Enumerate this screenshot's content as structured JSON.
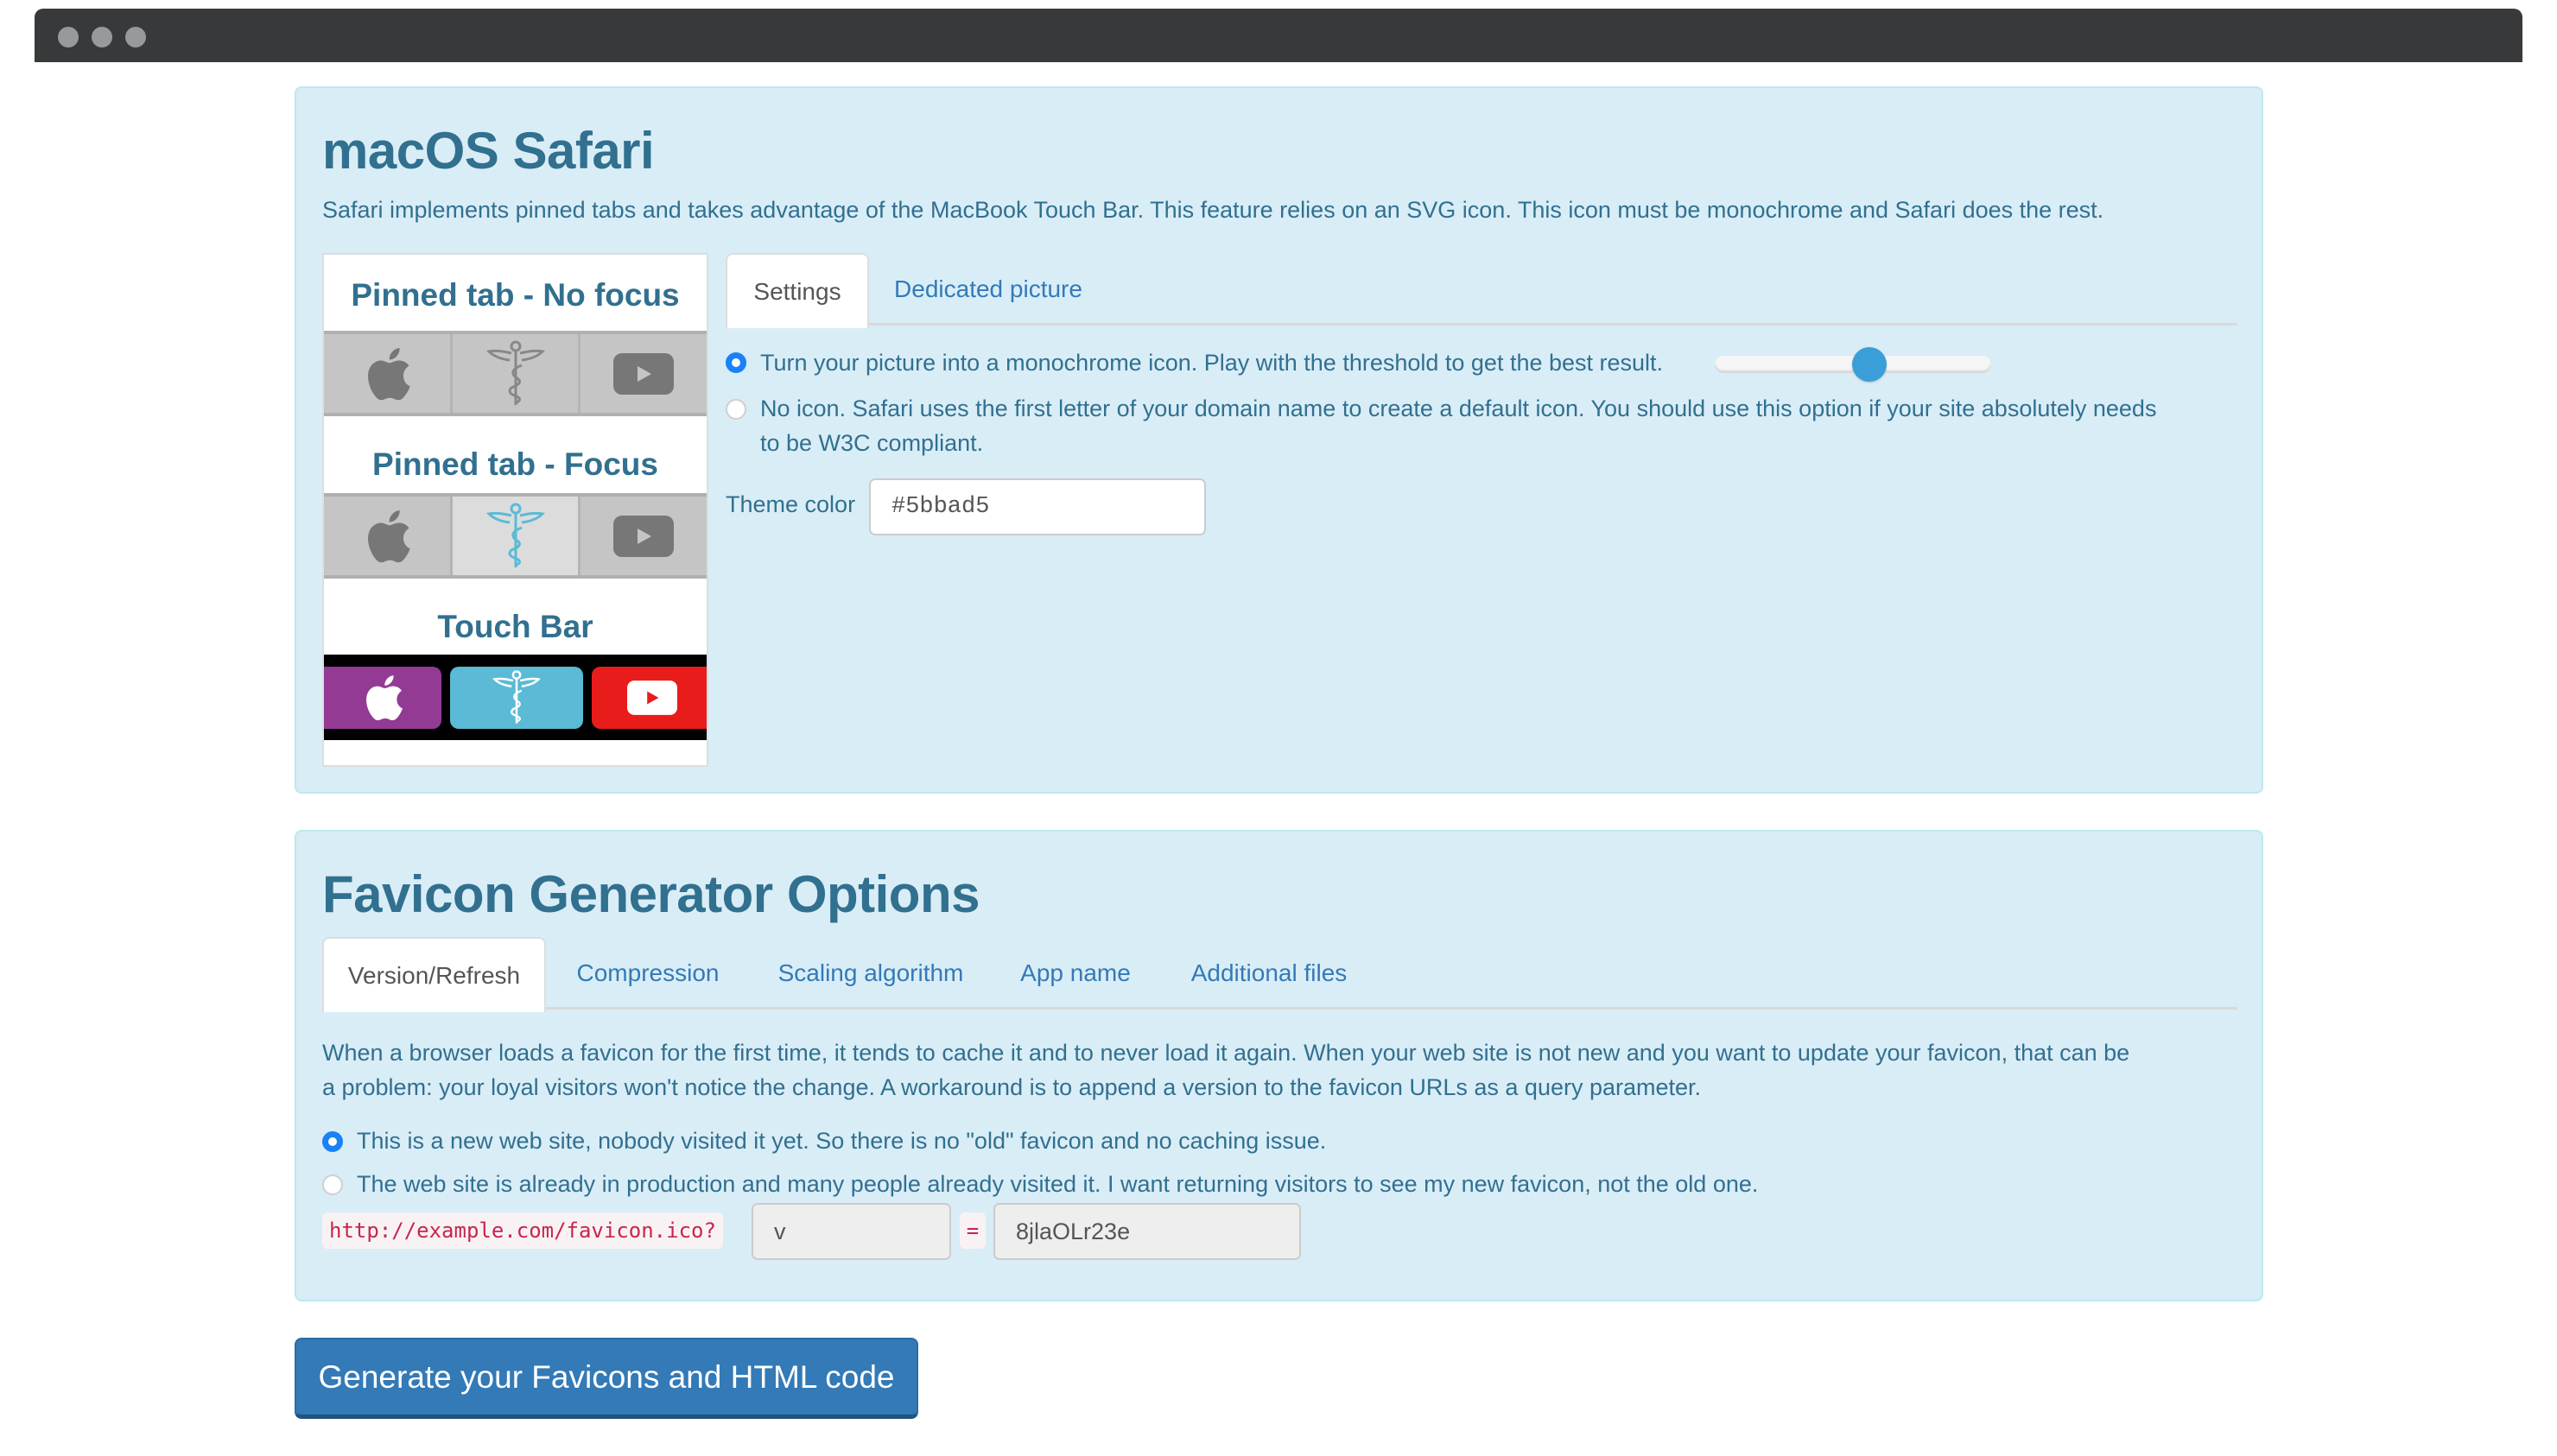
{
  "window": {
    "traffic_lights": [
      "close",
      "minimize",
      "zoom"
    ]
  },
  "safari_panel": {
    "title": "macOS Safari",
    "description": "Safari implements pinned tabs and takes advantage of the MacBook Touch Bar. This feature relies on an SVG icon. This icon must be monochrome and Safari does the rest.",
    "preview": {
      "no_focus_heading": "Pinned tab - No focus",
      "focus_heading": "Pinned tab - Focus",
      "touch_bar_heading": "Touch Bar",
      "icons": [
        "apple-icon",
        "caduceus-icon",
        "youtube-icon"
      ],
      "touch_bar_colors": [
        "#933a94",
        "#5bbad5",
        "#e91c1c"
      ],
      "focus_color": "#5bbad5"
    },
    "tabs": [
      {
        "label": "Settings",
        "active": true
      },
      {
        "label": "Dedicated picture",
        "active": false
      }
    ],
    "options": [
      {
        "label": "Turn your picture into a monochrome icon. Play with the threshold to get the best result.",
        "checked": true
      },
      {
        "label_line1": "No icon. Safari uses the first letter of your domain name to create a default icon. You should use this option if your site absolutely needs",
        "label_line2": "to be W3C compliant.",
        "checked": false
      }
    ],
    "threshold_slider": {
      "value_percent": 56
    },
    "theme_color": {
      "label": "Theme color",
      "value": "#5bbad5"
    }
  },
  "options_panel": {
    "title": "Favicon Generator Options",
    "tabs": [
      {
        "label": "Version/Refresh",
        "active": true
      },
      {
        "label": "Compression",
        "active": false
      },
      {
        "label": "Scaling algorithm",
        "active": false
      },
      {
        "label": "App name",
        "active": false
      },
      {
        "label": "Additional files",
        "active": false
      }
    ],
    "paragraph_line1": "When a browser loads a favicon for the first time, it tends to cache it and to never load it again. When your web site is not new and you want to update your favicon, that can be",
    "paragraph_line2": "a problem: your loyal visitors won't notice the change. A workaround is to append a version to the favicon URLs as a query parameter.",
    "options": [
      {
        "label": "This is a new web site, nobody visited it yet. So there is no \"old\" favicon and no caching issue.",
        "checked": true
      },
      {
        "label": "The web site is already in production and many people already visited it. I want returning visitors to see my new favicon, not the old one.",
        "checked": false
      }
    ],
    "url_prefix": "http://example.com/favicon.ico?",
    "param_name": "v",
    "equals": "=",
    "param_value": "8jlaOLr23e"
  },
  "generate_button": {
    "label": "Generate your Favicons and HTML code"
  }
}
